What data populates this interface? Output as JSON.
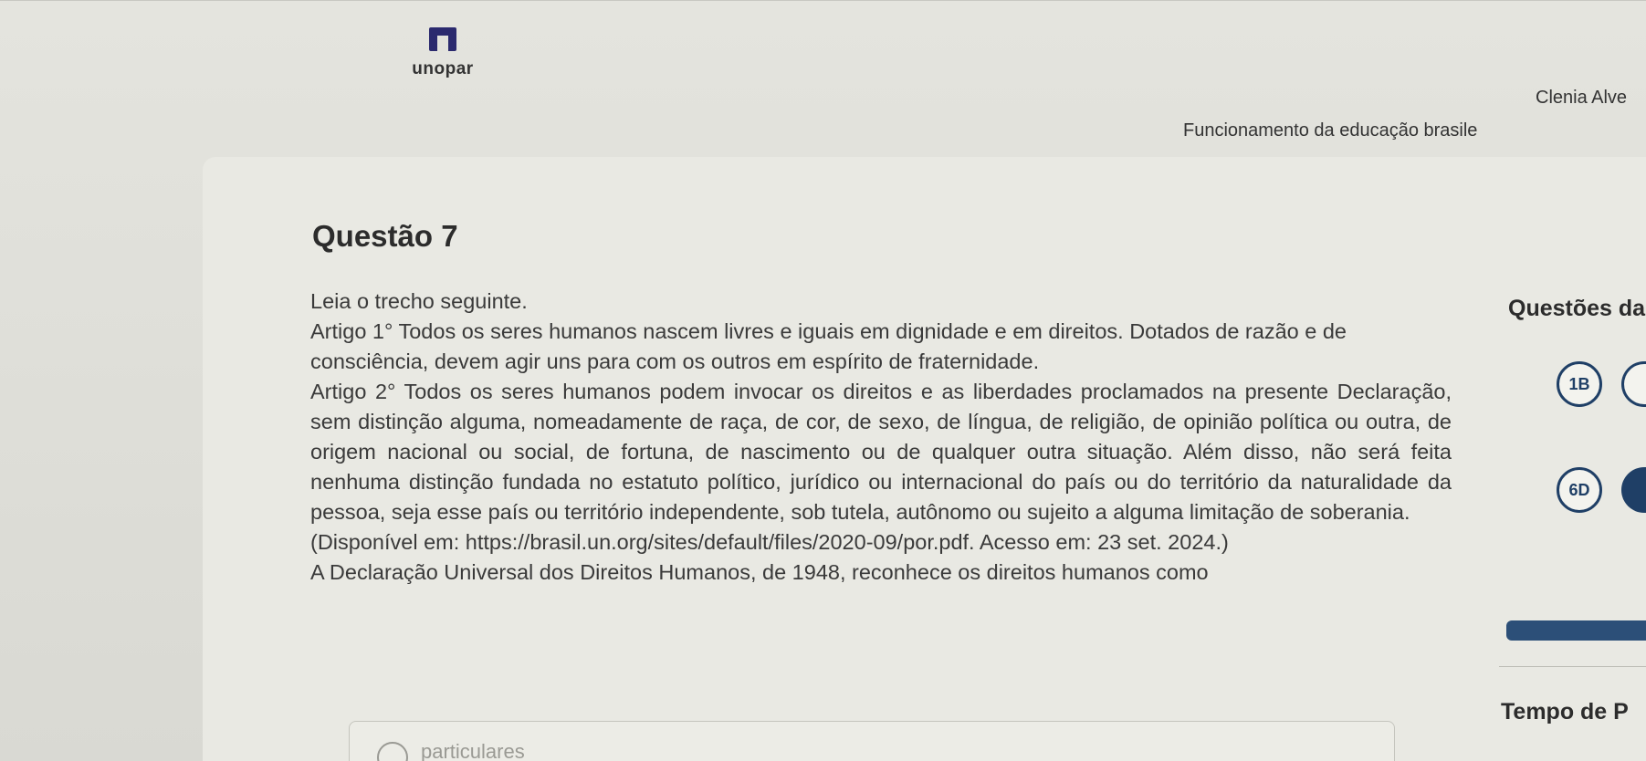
{
  "header": {
    "brand": "unopar",
    "user_name": "Clenia Alve",
    "course_name": "Funcionamento da educação brasile"
  },
  "question": {
    "title": "Questão 7",
    "intro": "Leia o trecho seguinte.",
    "article1": "Artigo 1° Todos os seres humanos nascem livres e iguais em dignidade e em direitos. Dotados de razão e de consciência, devem agir uns para com os outros em espírito de fraternidade.",
    "article2": "Artigo 2° Todos os seres humanos podem invocar os direitos e as liberdades proclamados na presente Declaração, sem distinção alguma, nomeadamente de raça, de cor, de sexo, de língua, de religião, de opinião política ou outra, de origem nacional ou social, de fortuna, de nascimento ou de qualquer outra situação. Além disso, não será feita nenhuma distinção fundada no estatuto político, jurídico ou internacional do país ou do território da naturalidade da pessoa, seja esse país ou território independente, sob tutela, autônomo ou sujeito a alguma limitação de soberania.",
    "source": "(Disponível em: https://brasil.un.org/sites/default/files/2020-09/por.pdf. Acesso em: 23 set. 2024.)",
    "prompt": "A Declaração Universal dos Direitos Humanos, de 1948, reconhece os direitos humanos como",
    "option_a": "particulares"
  },
  "sidebar": {
    "title": "Questões da",
    "badges": [
      "1B",
      "6D"
    ],
    "timer_label": "Tempo de P"
  },
  "colors": {
    "accent": "#1f3f66",
    "brand": "#2b2a6e"
  }
}
